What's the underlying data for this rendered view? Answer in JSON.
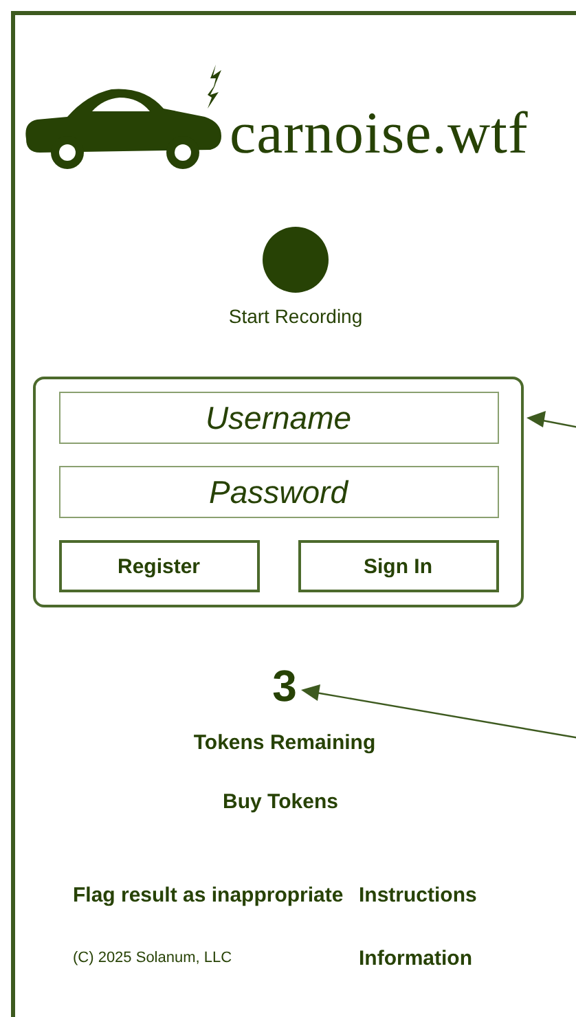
{
  "logo": {
    "text": "carnoise.wtf"
  },
  "record": {
    "label": "Start Recording"
  },
  "login": {
    "username": {
      "placeholder": "Username"
    },
    "password": {
      "placeholder": "Password"
    },
    "buttons": [
      "Register",
      "Sign In"
    ]
  },
  "tokens": {
    "count": "3",
    "label": "Tokens Remaining",
    "buy": "Buy Tokens"
  },
  "footer": {
    "flag": "Flag result as inappropriate",
    "instructions": "Instructions",
    "copyright": "(C) 2025 Solanum, LLC",
    "information": "Information"
  }
}
